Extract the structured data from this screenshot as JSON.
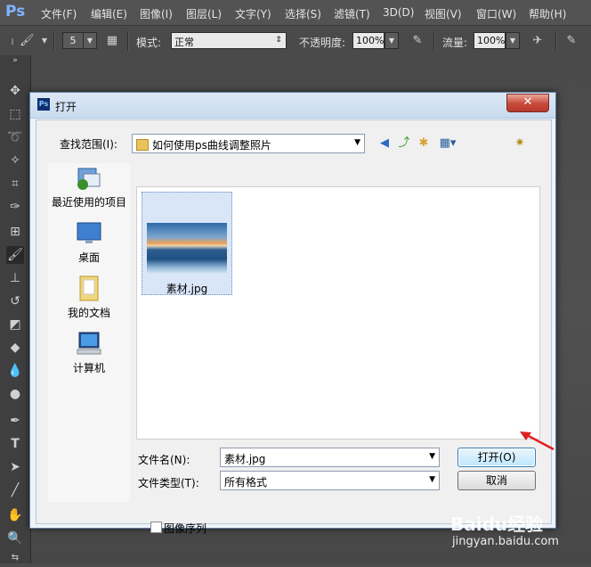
{
  "app": {
    "logo": "Ps",
    "menu": [
      "文件(F)",
      "编辑(E)",
      "图像(I)",
      "图层(L)",
      "文字(Y)",
      "选择(S)",
      "滤镜(T)",
      "3D(D)",
      "视图(V)",
      "窗口(W)",
      "帮助(H)"
    ]
  },
  "options": {
    "brush_size": "5",
    "mode_label": "模式:",
    "mode_value": "正常",
    "opacity_label": "不透明度:",
    "opacity_value": "100%",
    "flow_label": "流量:",
    "flow_value": "100%"
  },
  "dialog": {
    "icon_label": "Ps",
    "title": "打开",
    "close_label": "✕",
    "lookin_label": "查找范围(I):",
    "lookin_value": "如何使用ps曲线调整照片",
    "places": [
      {
        "label": "最近使用的项目",
        "icon": "recent-items-icon"
      },
      {
        "label": "桌面",
        "icon": "desktop-icon"
      },
      {
        "label": "我的文档",
        "icon": "documents-folder-icon"
      },
      {
        "label": "计算机",
        "icon": "computer-icon"
      }
    ],
    "files": [
      {
        "name": "素材.jpg",
        "icon": "image-thumbnail"
      }
    ],
    "filename_label": "文件名(N):",
    "filename_value": "素材.jpg",
    "filetype_label": "文件类型(T):",
    "filetype_value": "所有格式",
    "open_button": "打开(O)",
    "cancel_button": "取消",
    "sequence_label": "图像序列",
    "sequence_checked": false
  },
  "watermark": {
    "brand": "Baidu经验",
    "url": "jingyan.baidu.com"
  },
  "colors": {
    "close_red": "#c7493a",
    "annotation_arrow": "#e02020"
  }
}
